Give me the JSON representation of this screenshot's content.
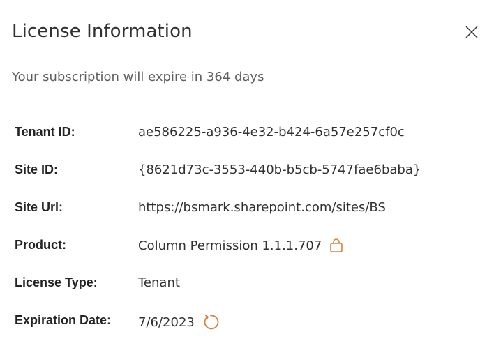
{
  "dialog": {
    "title": "License Information",
    "subtitle": "Your subscription will expire in 364 days",
    "close_icon": "close-icon"
  },
  "details": [
    {
      "label": "Tenant ID:",
      "value": "ae586225-a936-4e32-b424-6a57e257cf0c"
    },
    {
      "label": "Site ID:",
      "value": "{8621d73c-3553-440b-b5cb-5747fae6baba}"
    },
    {
      "label": "Site Url:",
      "value": "https://bsmark.sharepoint.com/sites/BS"
    },
    {
      "label": "Product:",
      "value": "Column Permission 1.1.1.707",
      "icon": "shopping-bag-icon"
    },
    {
      "label": "License Type:",
      "value": "Tenant"
    },
    {
      "label": "Expiration Date:",
      "value": "7/6/2023",
      "icon": "refresh-icon"
    }
  ],
  "colors": {
    "accent": "#d9803f",
    "title": "#323130",
    "subtitle": "#605e5c"
  }
}
